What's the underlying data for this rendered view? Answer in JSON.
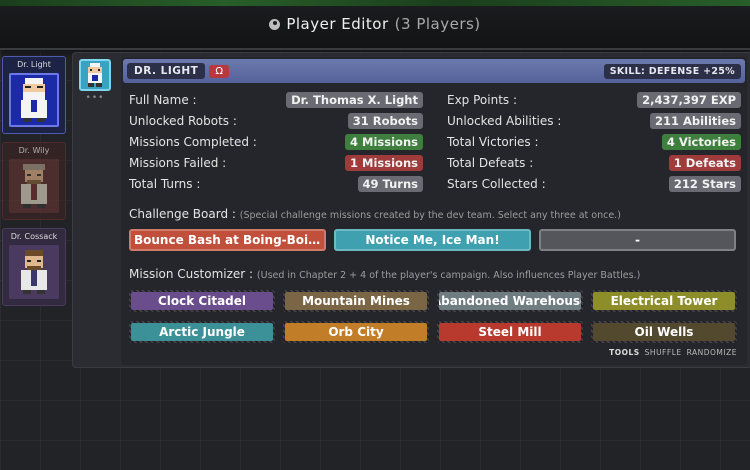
{
  "header": {
    "title": "Player Editor",
    "count": "(3 Players)"
  },
  "sidebar": {
    "players": [
      {
        "name": "Dr. Light",
        "active": true
      },
      {
        "name": "Dr. Wily",
        "active": false
      },
      {
        "name": "Dr. Cossack",
        "active": false
      }
    ]
  },
  "panel": {
    "dots": "•••",
    "title_bar": {
      "name": "DR. LIGHT",
      "omega": "Ω",
      "skill": "SKILL: DEFENSE +25%"
    },
    "stats": {
      "full_name_label": "Full Name :",
      "full_name": "Dr. Thomas X. Light",
      "exp_label": "Exp Points :",
      "exp": "2,437,397 EXP",
      "robots_label": "Unlocked Robots :",
      "robots": "31 Robots",
      "abilities_label": "Unlocked Abilities :",
      "abilities": "211 Abilities",
      "missions_completed_label": "Missions Completed :",
      "missions_completed": "4 Missions",
      "victories_label": "Total Victories :",
      "victories": "4 Victories",
      "missions_failed_label": "Missions Failed :",
      "missions_failed": "1 Missions",
      "defeats_label": "Total Defeats :",
      "defeats": "1 Defeats",
      "turns_label": "Total Turns :",
      "turns": "49 Turns",
      "stars_label": "Stars Collected :",
      "stars": "212 Stars"
    },
    "challenge_board": {
      "title": "Challenge Board :",
      "note": "(Special challenge missions created by the dev team. Select any three at once.)",
      "items": [
        {
          "label": "Bounce Bash at Boing-Boing",
          "color": "#c0503c"
        },
        {
          "label": "Notice Me, Ice Man!",
          "color": "#3fa0b0"
        },
        {
          "label": "-",
          "color": "#5a5b61"
        }
      ]
    },
    "mission_customizer": {
      "title": "Mission Customizer :",
      "note": "(Used in Chapter 2 + 4 of the player's campaign. Also influences Player Battles.)",
      "items": [
        {
          "label": "Clock Citadel",
          "color": "#6a4d8c"
        },
        {
          "label": "Mountain Mines",
          "color": "#7a6545"
        },
        {
          "label": "Abandoned Warehouse",
          "color": "#6f7c82"
        },
        {
          "label": "Electrical Tower",
          "color": "#8d8d2a"
        },
        {
          "label": "Arctic Jungle",
          "color": "#3c9198"
        },
        {
          "label": "Orb City",
          "color": "#c27d28"
        },
        {
          "label": "Steel Mill",
          "color": "#b83a2e"
        },
        {
          "label": "Oil Wells",
          "color": "#53492f"
        }
      ]
    },
    "tools": {
      "label": "TOOLS",
      "shuffle": "SHUFFLE",
      "randomize": "RANDOMIZE"
    }
  }
}
